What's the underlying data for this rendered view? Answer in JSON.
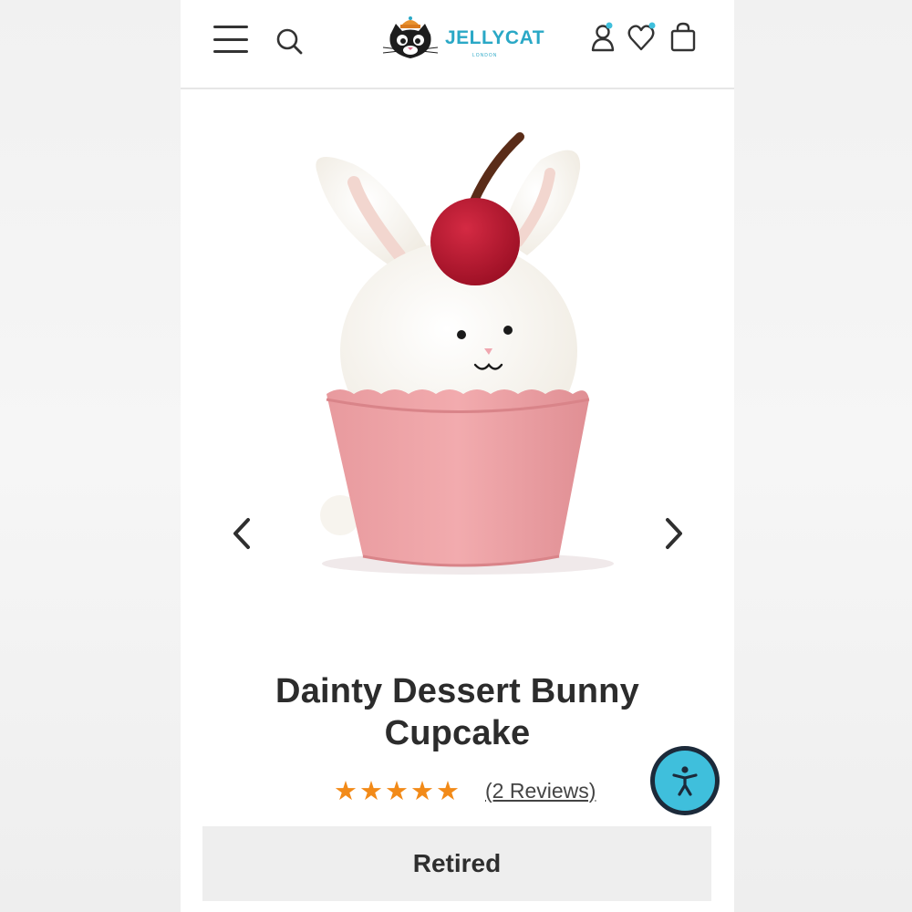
{
  "brand": {
    "name": "JELLYCAT",
    "sub": "LONDON",
    "color": "#2aa8c6"
  },
  "header": {
    "icons": [
      "menu-icon",
      "search-icon",
      "account-icon",
      "wishlist-icon",
      "bag-icon"
    ],
    "notification_dot_color": "#3fbfdc"
  },
  "product": {
    "title": "Dainty Dessert Bunny Cupcake",
    "rating": {
      "stars": 5,
      "max": 5,
      "star_glyph": "★",
      "color": "#f28a18"
    },
    "reviews_label": "(2 Reviews)",
    "status_label": "Retired",
    "image_alt": "bunny-cupcake-plush"
  },
  "carousel": {
    "prev_icon": "chevron-left-icon",
    "next_icon": "chevron-right-icon"
  },
  "accessibility": {
    "icon": "accessibility-icon",
    "color": "#3fbfdc"
  }
}
